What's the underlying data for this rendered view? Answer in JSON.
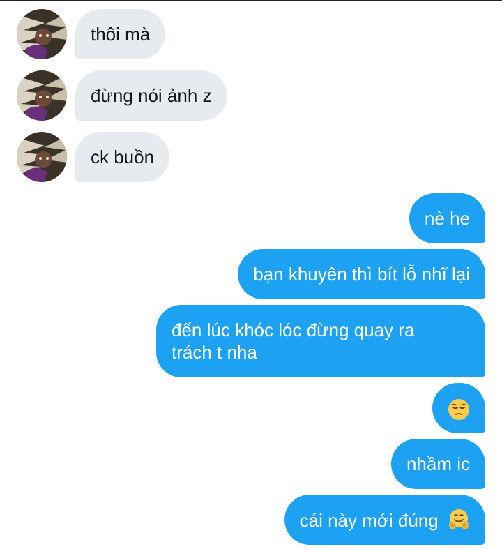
{
  "messages": {
    "incoming": [
      {
        "text": "thôi mà"
      },
      {
        "text": "đừng nói ảnh z"
      },
      {
        "text": "ck buồn"
      }
    ],
    "outgoing": [
      {
        "text": "nè he"
      },
      {
        "text": "bạn khuyên thì bít lỗ nhĩ lại"
      },
      {
        "line1": "đến lúc khóc lóc đừng quay ra",
        "line2": "trách t nha"
      },
      {
        "emoji": "pensive-face"
      },
      {
        "text": "nhầm ic"
      },
      {
        "text": "cái này mới đúng",
        "emoji": "hugging-face"
      }
    ]
  },
  "colors": {
    "incoming_bubble": "#e7ebef",
    "outgoing_bubble": "#1da1f2",
    "incoming_text": "#14171a",
    "outgoing_text": "#ffffff"
  }
}
